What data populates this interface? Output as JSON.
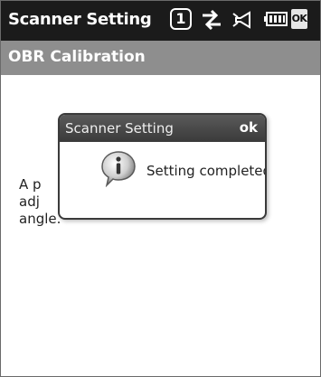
{
  "titlebar": {
    "title": "Scanner Setting",
    "notification_count": "1",
    "ok_label": "OK",
    "icons": [
      "notification-icon",
      "connectivity-icon",
      "volume-icon",
      "battery-icon"
    ]
  },
  "page": {
    "title": "OBR Calibration"
  },
  "body": {
    "lines": [
      "A p",
      "adj",
      "angle."
    ]
  },
  "dialog": {
    "title": "Scanner Setting",
    "ok_label": "ok",
    "message": "Setting completed.",
    "icon": "info-icon"
  }
}
